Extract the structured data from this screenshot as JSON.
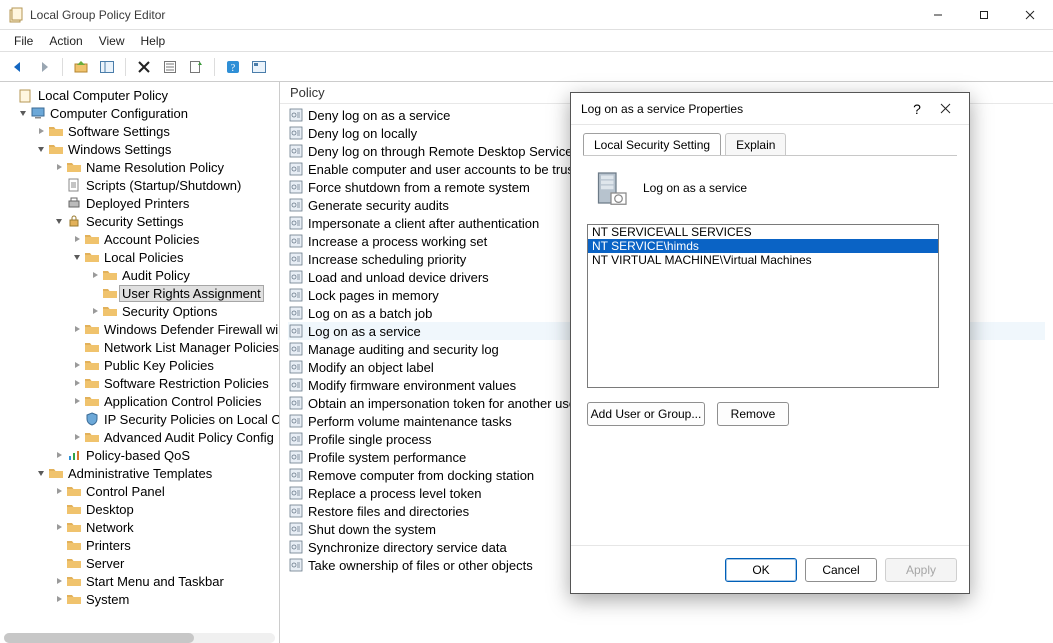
{
  "window": {
    "title": "Local Group Policy Editor"
  },
  "menus": {
    "file": "File",
    "action": "Action",
    "view": "View",
    "help": "Help"
  },
  "tree": {
    "root": "Local Computer Policy",
    "computer_configuration": "Computer Configuration",
    "software_settings": "Software Settings",
    "windows_settings": "Windows Settings",
    "name_resolution_policy": "Name Resolution Policy",
    "scripts": "Scripts (Startup/Shutdown)",
    "deployed_printers": "Deployed Printers",
    "security_settings": "Security Settings",
    "account_policies": "Account Policies",
    "local_policies": "Local Policies",
    "audit_policy": "Audit Policy",
    "user_rights_assignment": "User Rights Assignment",
    "security_options": "Security Options",
    "wdfw": "Windows Defender Firewall wi",
    "nlmp": "Network List Manager Policies",
    "pk_policies": "Public Key Policies",
    "srp": "Software Restriction Policies",
    "acp": "Application Control Policies",
    "ipsec": "IP Security Policies on Local C",
    "aapc": "Advanced Audit Policy Config",
    "pbqos": "Policy-based QoS",
    "admin_templates": "Administrative Templates",
    "control_panel": "Control Panel",
    "desktop": "Desktop",
    "network": "Network",
    "printers": "Printers",
    "server": "Server",
    "start_menu": "Start Menu and Taskbar",
    "system": "System"
  },
  "listHeader": "Policy",
  "policies": {
    "i0": "Deny log on as a service",
    "i1": "Deny log on locally",
    "i2": "Deny log on through Remote Desktop Services",
    "i3": "Enable computer and user accounts to be trusted",
    "i4": "Force shutdown from a remote system",
    "i5": "Generate security audits",
    "i6": "Impersonate a client after authentication",
    "i7": "Increase a process working set",
    "i8": "Increase scheduling priority",
    "i9": "Load and unload device drivers",
    "i10": "Lock pages in memory",
    "i11": "Log on as a batch job",
    "i12": "Log on as a service",
    "i13": "Manage auditing and security log",
    "i14": "Modify an object label",
    "i15": "Modify firmware environment values",
    "i16": "Obtain an impersonation token for another user in",
    "i17": "Perform volume maintenance tasks",
    "i18": "Profile single process",
    "i19": "Profile system performance",
    "i20": "Remove computer from docking station",
    "i21": "Replace a process level token",
    "i22": "Restore files and directories",
    "i23": "Shut down the system",
    "i24": "Synchronize directory service data",
    "i25": "Take ownership of files or other objects"
  },
  "dialog": {
    "title": "Log on as a service Properties",
    "tab_local": "Local Security Setting",
    "tab_explain": "Explain",
    "policy_name": "Log on as a service",
    "members": {
      "m0": "NT SERVICE\\ALL SERVICES",
      "m1": "NT SERVICE\\himds",
      "m2": "NT VIRTUAL MACHINE\\Virtual Machines"
    },
    "add_user": "Add User or Group...",
    "remove": "Remove",
    "ok": "OK",
    "cancel": "Cancel",
    "apply": "Apply"
  }
}
